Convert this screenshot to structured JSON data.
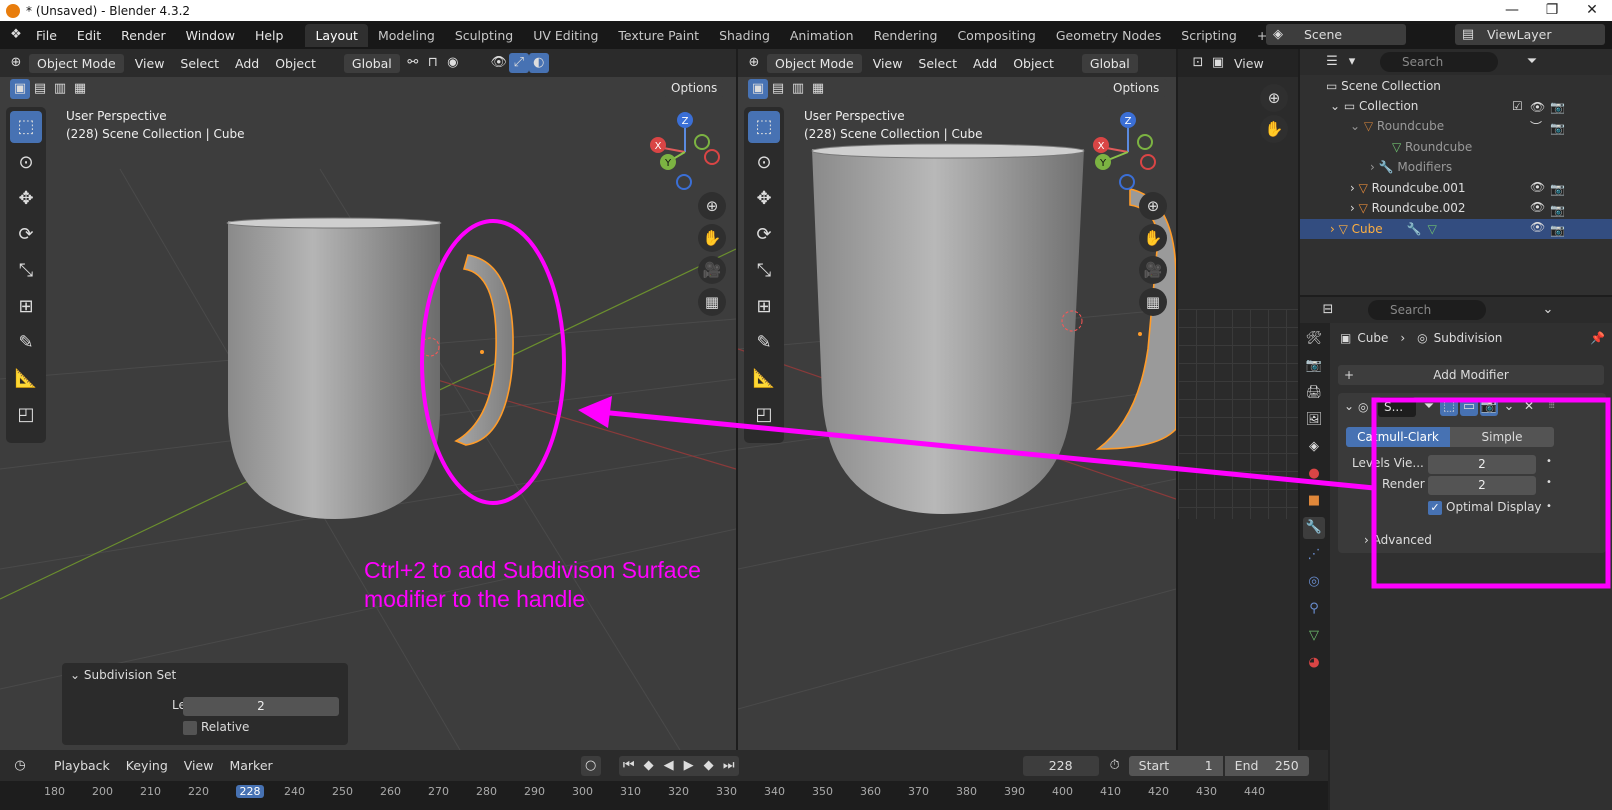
{
  "window": {
    "title": "* (Unsaved) - Blender 4.3.2",
    "minimize": "—",
    "maximize": "❐",
    "close": "✕"
  },
  "menu": [
    "File",
    "Edit",
    "Render",
    "Window",
    "Help"
  ],
  "workspaces": [
    "Layout",
    "Modeling",
    "Sculpting",
    "UV Editing",
    "Texture Paint",
    "Shading",
    "Animation",
    "Rendering",
    "Compositing",
    "Geometry Nodes",
    "Scripting",
    "+"
  ],
  "scene": {
    "name": "Scene",
    "view_layer": "ViewLayer"
  },
  "viewport_left": {
    "mode": "Object Mode",
    "view": "View",
    "select": "Select",
    "add": "Add",
    "object": "Object",
    "orientation": "Global",
    "options": "Options",
    "perspective": "User Perspective",
    "collection_info": "(228) Scene Collection | Cube"
  },
  "viewport_right": {
    "mode": "Object Mode",
    "view": "View",
    "select": "Select",
    "add": "Add",
    "object": "Object",
    "orientation": "Global",
    "options": "Options",
    "perspective": "User Perspective",
    "collection_info": "(228) Scene Collection | Cube"
  },
  "image_editor": {
    "view": "View"
  },
  "gizmo": {
    "x": "X",
    "y": "Y",
    "z": "Z"
  },
  "annotation": {
    "line1": "Ctrl+2 to add Subdivison Surface",
    "line2": "modifier to the handle",
    "color": "#ff00ff"
  },
  "last_op": {
    "title": "Subdivision Set",
    "level_label": "Level",
    "level_value": "2",
    "relative_label": "Relative",
    "relative": false
  },
  "outliner": {
    "search_placeholder": "Search",
    "items": [
      {
        "label": "Scene Collection"
      },
      {
        "label": "Collection"
      },
      {
        "label": "Roundcube"
      },
      {
        "label": "Roundcube"
      },
      {
        "label": "Modifiers"
      },
      {
        "label": "Roundcube.001"
      },
      {
        "label": "Roundcube.002"
      },
      {
        "label": "Cube"
      }
    ]
  },
  "properties": {
    "search_placeholder": "Search",
    "breadcrumb_object": "Cube",
    "breadcrumb_modifier": "Subdivision",
    "add_modifier": "Add Modifier",
    "modifier_name": "S...",
    "catmull_clark": "Catmull-Clark",
    "simple": "Simple",
    "levels_viewport_label": "Levels Vie...",
    "levels_viewport_value": "2",
    "render_label": "Render",
    "render_value": "2",
    "optimal_display_label": "Optimal Display",
    "optimal_display": true,
    "advanced": "Advanced"
  },
  "timeline": {
    "playback": "Playback",
    "keying": "Keying",
    "view": "View",
    "marker": "Marker",
    "current_frame": "228",
    "start_label": "Start",
    "start_value": "1",
    "end_label": "End",
    "end_value": "250"
  },
  "ruler": [
    "180",
    "200",
    "210",
    "220",
    "228",
    "240",
    "250",
    "260",
    "270",
    "280",
    "290",
    "300",
    "310",
    "320",
    "330",
    "340",
    "350",
    "360",
    "370",
    "380",
    "390",
    "400",
    "410",
    "420",
    "430",
    "440"
  ]
}
